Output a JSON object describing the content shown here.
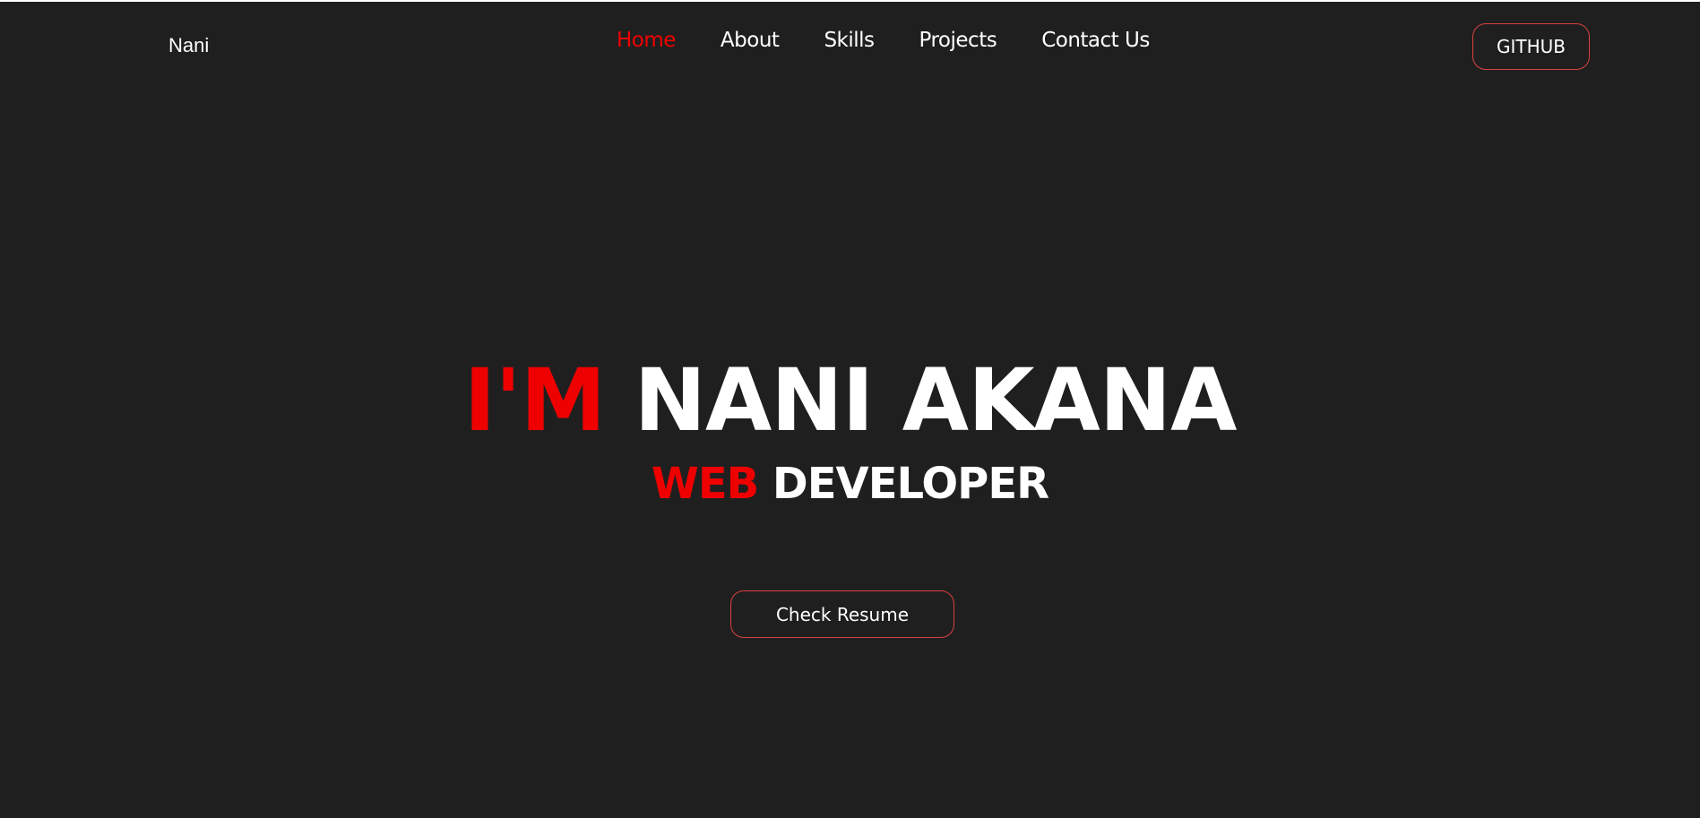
{
  "header": {
    "logo_text": "Nani",
    "nav": [
      {
        "label": "Home",
        "active": true
      },
      {
        "label": "About",
        "active": false
      },
      {
        "label": "Skills",
        "active": false
      },
      {
        "label": "Projects",
        "active": false
      },
      {
        "label": "Contact Us",
        "active": false
      }
    ],
    "github_label": "GITHUB"
  },
  "hero": {
    "title_accent": "I'M",
    "title_main": "NANI AKANA",
    "subtitle_accent": "WEB",
    "subtitle_main": "DEVELOPER",
    "resume_label": "Check Resume"
  },
  "colors": {
    "background": "#201f20",
    "accent": "#ef0000",
    "text": "#ffffff",
    "button_border": "#d9413f"
  }
}
